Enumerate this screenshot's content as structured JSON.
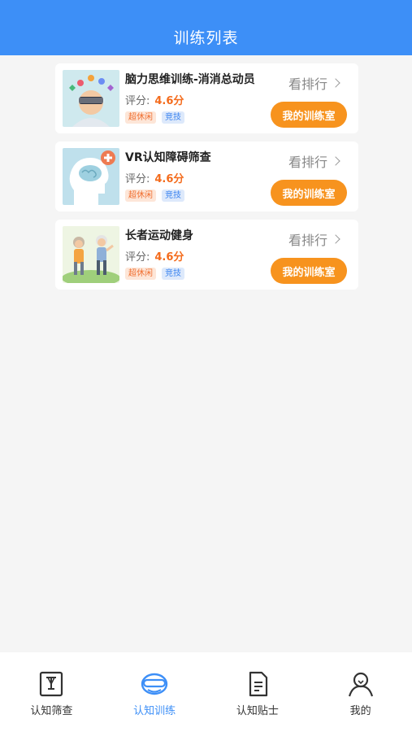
{
  "header": {
    "title": "训练列表"
  },
  "common": {
    "rating_prefix": "评分:",
    "rank_label": "看排行",
    "room_button": "我的训练室"
  },
  "items": [
    {
      "title": "脑力思维训练-消消总动员",
      "rating": "4.6分",
      "tags": [
        "超休闲",
        "竞技"
      ]
    },
    {
      "title": "VR认知障碍筛查",
      "rating": "4.6分",
      "tags": [
        "超休闲",
        "竞技"
      ]
    },
    {
      "title": "长者运动健身",
      "rating": "4.6分",
      "tags": [
        "超休闲",
        "竞技"
      ]
    }
  ],
  "tabs": [
    {
      "label": "认知筛查",
      "icon": "screening-icon",
      "active": false
    },
    {
      "label": "认知训练",
      "icon": "vr-headset-icon",
      "active": true
    },
    {
      "label": "认知贴士",
      "icon": "document-icon",
      "active": false
    },
    {
      "label": "我的",
      "icon": "person-icon",
      "active": false
    }
  ],
  "colors": {
    "primary": "#3d8ff7",
    "accent_orange": "#f7931e",
    "rating_orange": "#f46b1c"
  }
}
